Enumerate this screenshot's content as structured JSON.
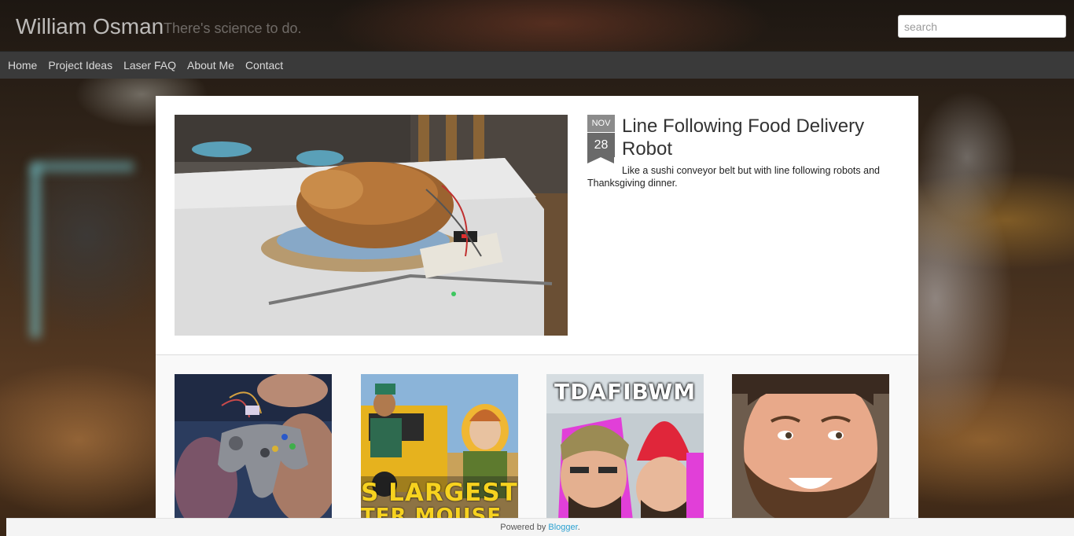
{
  "header": {
    "site_title": "William Osman",
    "tagline": "There's science to do.",
    "search_placeholder": "search"
  },
  "nav": {
    "items": [
      {
        "label": "Home"
      },
      {
        "label": "Project Ideas"
      },
      {
        "label": "Laser FAQ"
      },
      {
        "label": "About Me"
      },
      {
        "label": "Contact"
      }
    ]
  },
  "featured_post": {
    "month": "NOV",
    "day": "28",
    "title": "Line Following Food Delivery Robot",
    "snippet": "Like a sushi conveyor belt but with line following robots and Thanksgiving dinner.",
    "image": "roast-turkey-on-robot"
  },
  "thumbnails": [
    {
      "image": "n64-controller-circuit"
    },
    {
      "image": "people-at-yellow-truck",
      "overlay_text": "S LARGEST",
      "overlay_text2": "TER MOUSE"
    },
    {
      "image": "two-men-red-hat",
      "overlay_text": "TDAFIBWM"
    },
    {
      "image": "bearded-man-smiling"
    }
  ],
  "footer": {
    "powered_by": "Powered by",
    "link": "Blogger",
    "suffix": "."
  }
}
